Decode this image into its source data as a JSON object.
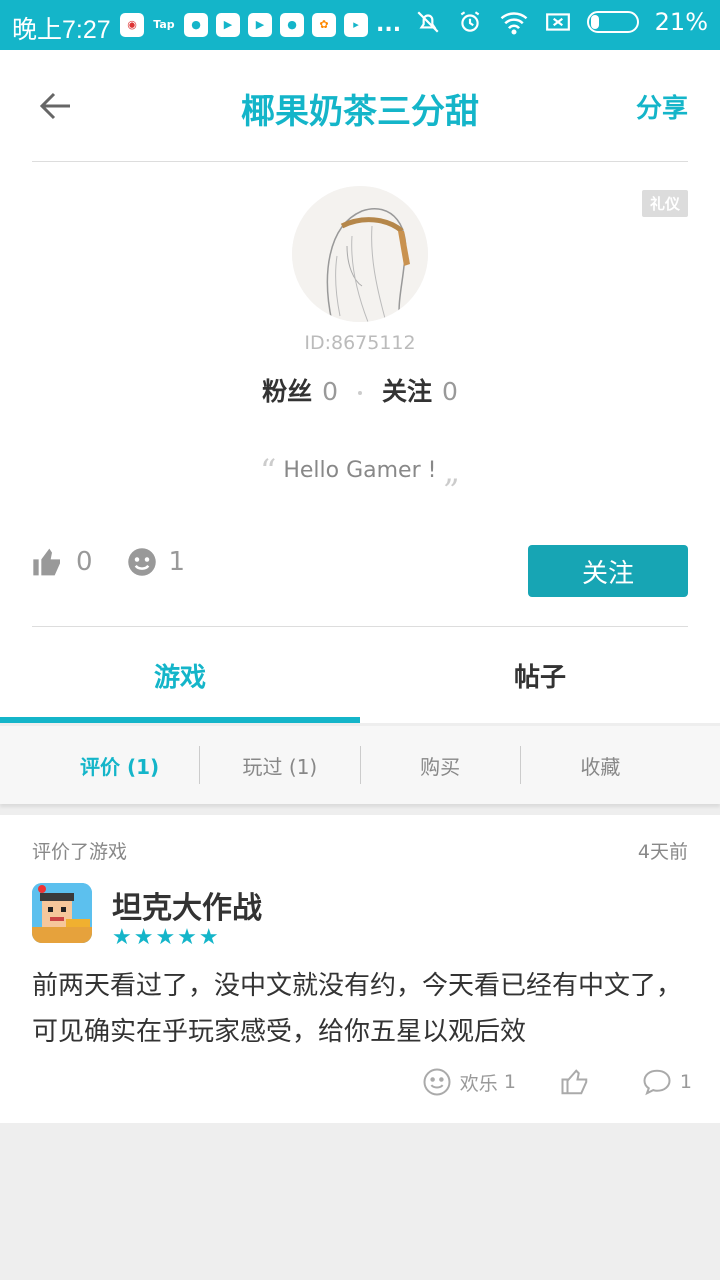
{
  "status_bar": {
    "time": "晚上7:27",
    "battery": "21%",
    "more": "..."
  },
  "header": {
    "title": "椰果奶茶三分甜",
    "share": "分享"
  },
  "profile": {
    "tag": "礼仪",
    "id": "ID:8675112",
    "fans_label": "粉丝",
    "fans_count": "0",
    "following_label": "关注",
    "following_count": "0",
    "quote_open": "“",
    "quote_text": "Hello Gamer !",
    "quote_close": "„",
    "likes": "0",
    "smiles": "1",
    "follow_button": "关注"
  },
  "tabs": [
    {
      "label": "游戏"
    },
    {
      "label": "帖子"
    }
  ],
  "subtabs": [
    {
      "label": "评价 (1)"
    },
    {
      "label": "玩过 (1)"
    },
    {
      "label": "购买"
    },
    {
      "label": "收藏"
    }
  ],
  "review": {
    "meta": "评价了游戏",
    "time": "4天前",
    "game_name": "坦克大作战",
    "stars": "★★★★★",
    "text": "前两天看过了，没中文就没有约，今天看已经有中文了，可见确实在乎玩家感受，给你五星以观后效",
    "fun_label": "欢乐",
    "fun_count": "1",
    "comment_count": "1"
  },
  "colors": {
    "accent": "#14b5c9",
    "button": "#17a5b4"
  }
}
